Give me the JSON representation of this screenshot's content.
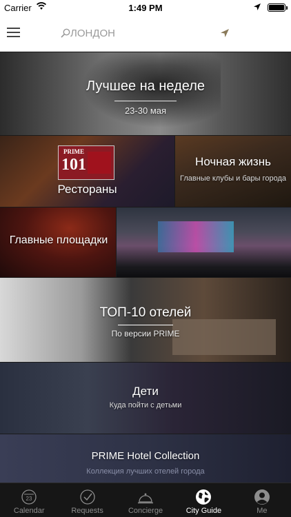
{
  "status_bar": {
    "carrier": "Carrier",
    "time": "1:49 PM",
    "battery_level": 1.0
  },
  "nav": {
    "menu_icon": "hamburger-icon",
    "search_icon": "magnifier-icon",
    "search_value": "ЛОНДОН",
    "location_icon": "location-arrow-icon",
    "location_color": "#8a7a5a"
  },
  "tiles": {
    "week": {
      "title": "Лучшее на неделе",
      "subtitle": "23-30 мая"
    },
    "restaurants": {
      "title": "Рестораны",
      "logo_top": "PRIME",
      "logo_number": "101"
    },
    "nightlife": {
      "title": "Ночная жизнь",
      "subtitle": "Главные клубы и бары города"
    },
    "venues": {
      "title": "Главные площадки"
    },
    "hotels": {
      "title": "ТОП-10 отелей",
      "subtitle": "По версии PRIME"
    },
    "kids": {
      "title": "Дети",
      "subtitle": "Куда пойти с детьми"
    },
    "collection": {
      "title": "PRIME Hotel Collection",
      "subtitle": "Коллекция лучших отелей города"
    }
  },
  "tab_bar": {
    "tabs": [
      {
        "label": "Calendar",
        "icon": "calendar-icon",
        "badge": "23",
        "active": false
      },
      {
        "label": "Requests",
        "icon": "checkmark-circle-icon",
        "active": false
      },
      {
        "label": "Concierge",
        "icon": "service-bell-icon",
        "active": false
      },
      {
        "label": "City Guide",
        "icon": "globe-icon",
        "active": true
      },
      {
        "label": "Me",
        "icon": "person-icon",
        "active": false
      }
    ]
  }
}
